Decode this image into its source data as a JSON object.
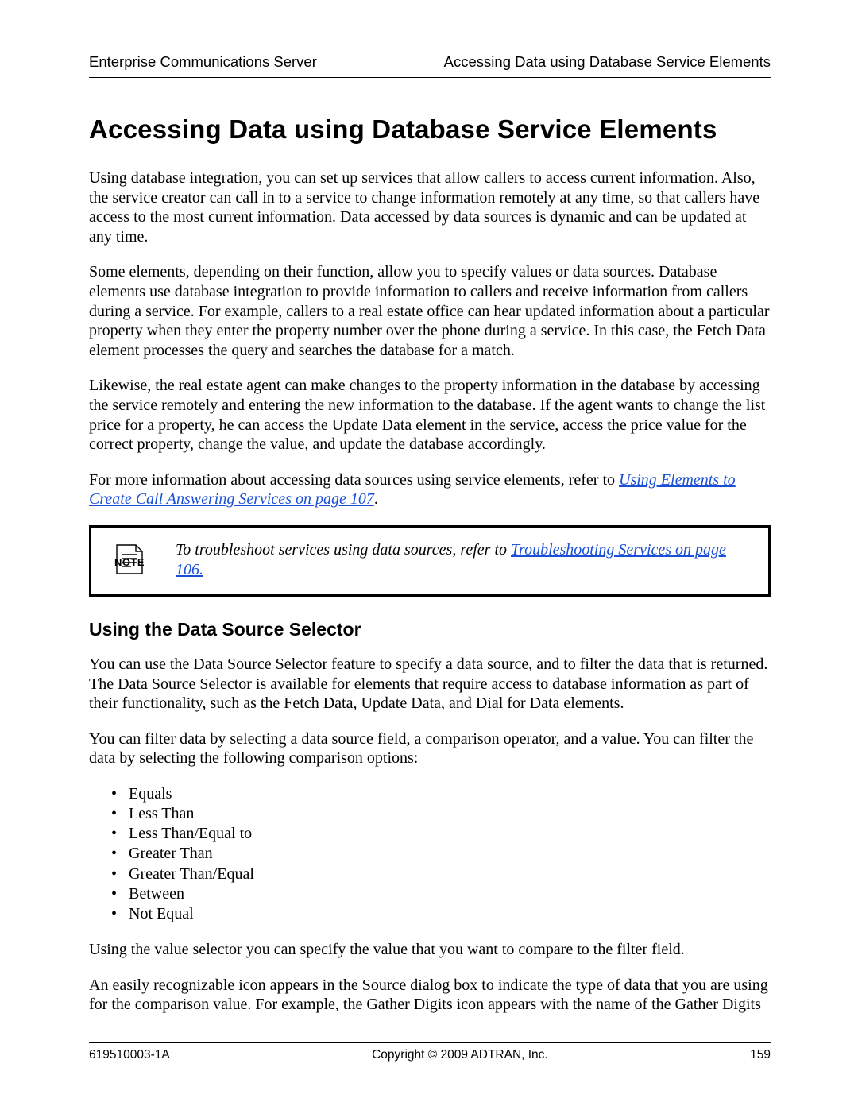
{
  "header": {
    "left": "Enterprise Communications Server",
    "right": "Accessing Data using Database Service Elements"
  },
  "title": "Accessing Data using Database Service Elements",
  "paras": {
    "p1": "Using database integration, you can set up services that allow callers to access current information. Also, the service creator can call in to a service to change information remotely at any time, so that callers have access to the most current information. Data accessed by data sources is dynamic and can be updated at any time.",
    "p2": "Some elements, depending on their function, allow you to specify values or data sources. Database elements use database integration to provide information to callers and receive information from callers during a service. For example, callers to a real estate office can hear updated information about a particular property when they enter the property number over the phone during a service. In this case, the Fetch Data element processes the query and searches the database for a match.",
    "p3": "Likewise, the real estate agent can make changes to the property information in the database by accessing the service remotely and entering the new information to the database. If the agent wants to change the list price for a property, he can access the Update Data element in the service, access the price value for the correct property, change the value, and update the database accordingly.",
    "p4_pre": "For more information about accessing data sources using service elements, refer to ",
    "p4_link": "Using Elements to Create Call Answering Services on page 107",
    "p4_post": "."
  },
  "note": {
    "label": "NOTE",
    "pre": "To troubleshoot services using data sources, refer to ",
    "link": "Troubleshooting Services on page 106."
  },
  "subhead": "Using the Data Source Selector",
  "sub": {
    "p1": "You can use the Data Source Selector feature to specify a data source, and to filter the data that is returned. The Data Source Selector is available for elements that require access to database information as part of their functionality, such as the Fetch Data, Update Data, and Dial for Data elements.",
    "p2": "You can filter data by selecting a data source field, a comparison operator, and a value. You can filter the data by selecting the following comparison options:",
    "list": [
      "Equals",
      "Less Than",
      "Less Than/Equal to",
      "Greater Than",
      "Greater Than/Equal",
      "Between",
      "Not Equal"
    ],
    "p3": "Using the value selector you can specify the value that you want to compare to the filter field.",
    "p4": "An easily recognizable icon appears in the Source dialog box to indicate the type of data that you are using for the comparison value. For example, the Gather Digits icon appears with the name of the Gather Digits"
  },
  "footer": {
    "left": "619510003-1A",
    "center": "Copyright © 2009 ADTRAN, Inc.",
    "right": "159"
  }
}
